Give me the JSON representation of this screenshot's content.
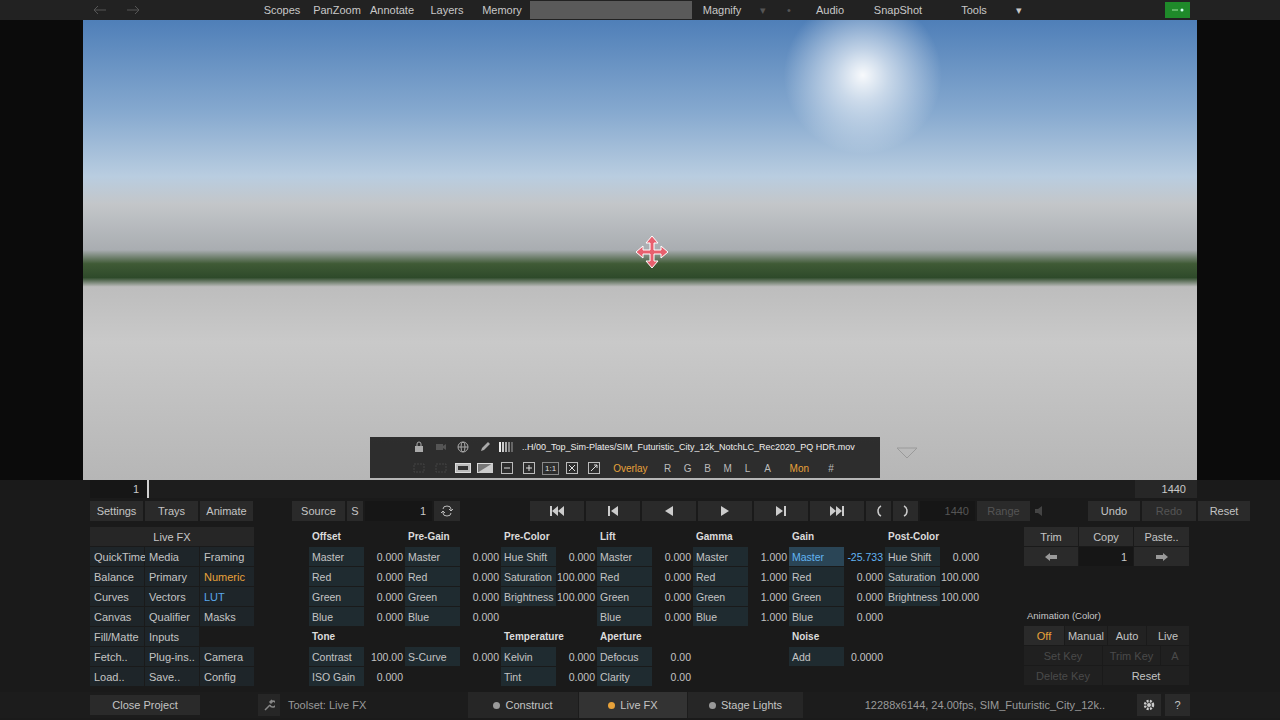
{
  "top_bar": {
    "menu": [
      {
        "label": "Scopes",
        "disabled": false
      },
      {
        "label": "PanZoom",
        "disabled": false
      },
      {
        "label": "Annotate",
        "disabled": false
      },
      {
        "label": "Layers",
        "disabled": false
      },
      {
        "label": "Memory",
        "disabled": false
      }
    ],
    "right_menu": [
      {
        "label": "Magnify",
        "disabled": false
      },
      {
        "label": "▾",
        "disabled": true
      },
      {
        "label": "•",
        "disabled": true
      },
      {
        "label": "Audio",
        "disabled": false
      },
      {
        "label": "SnapShot",
        "disabled": false
      },
      {
        "label": "Tools",
        "disabled": false
      },
      {
        "label": "▾",
        "disabled": false
      }
    ]
  },
  "viewer": {
    "filename": "..H/00_Top_Sim-Plates/SIM_Futuristic_City_12k_NotchLC_Rec2020_PQ HDR.mov",
    "zoom": "1:1",
    "toggles": [
      {
        "label": "Overlay",
        "on": true
      },
      {
        "label": "R",
        "on": false
      },
      {
        "label": "G",
        "on": false
      },
      {
        "label": "B",
        "on": false
      },
      {
        "label": "M",
        "on": false
      },
      {
        "label": "L",
        "on": false
      },
      {
        "label": "A",
        "on": false
      },
      {
        "label": "Mon",
        "on": true
      },
      {
        "label": "#",
        "on": false
      }
    ]
  },
  "timeline": {
    "start": "1",
    "end": "1440",
    "level": 0
  },
  "toolbar": {
    "left": [
      "Settings",
      "Trays",
      "Animate"
    ],
    "source": "Source",
    "s": "S",
    "frame": "1",
    "out_frame": {
      "value": "1440",
      "disabled": true
    },
    "range": {
      "label": "Range",
      "disabled": true
    },
    "edit": [
      {
        "label": "Undo",
        "disabled": false
      },
      {
        "label": "Redo",
        "disabled": true
      },
      {
        "label": "Reset",
        "disabled": false
      }
    ]
  },
  "menu": {
    "title": "Live FX",
    "items": [
      {
        "label": "QuickTime",
        "kind": "button",
        "selected": false,
        "highlighted": false
      },
      {
        "label": "Media",
        "kind": "button",
        "selected": false,
        "highlighted": false
      },
      {
        "label": "Framing",
        "kind": "button",
        "selected": false,
        "highlighted": false
      },
      {
        "label": "Balance",
        "kind": "button",
        "selected": false,
        "highlighted": false
      },
      {
        "label": "Primary",
        "kind": "button",
        "selected": false,
        "highlighted": false
      },
      {
        "label": "Numeric",
        "kind": "button",
        "selected": true,
        "highlighted": false
      },
      {
        "label": "Curves",
        "kind": "button",
        "selected": false,
        "highlighted": false
      },
      {
        "label": "Vectors",
        "kind": "button",
        "selected": false,
        "highlighted": false
      },
      {
        "label": "LUT",
        "kind": "button",
        "selected": false,
        "highlighted": true
      },
      {
        "label": "Canvas",
        "kind": "button",
        "selected": false,
        "highlighted": false
      },
      {
        "label": "Qualifier",
        "kind": "button",
        "selected": false,
        "highlighted": false
      },
      {
        "label": "Masks",
        "kind": "button",
        "selected": false,
        "highlighted": false
      },
      {
        "label": "Fill/Matte",
        "kind": "button",
        "selected": false,
        "highlighted": false
      },
      {
        "label": "Inputs",
        "kind": "button",
        "selected": false,
        "highlighted": false
      },
      {
        "label": "",
        "kind": "blank",
        "selected": false,
        "highlighted": false
      },
      {
        "label": "Fetch..",
        "kind": "button",
        "selected": false,
        "highlighted": false
      },
      {
        "label": "Plug-ins..",
        "kind": "button",
        "selected": false,
        "highlighted": false
      },
      {
        "label": "Camera",
        "kind": "button",
        "selected": false,
        "highlighted": false
      },
      {
        "label": "Load..",
        "kind": "button",
        "selected": false,
        "highlighted": false
      },
      {
        "label": "Save..",
        "kind": "button",
        "selected": false,
        "highlighted": false
      },
      {
        "label": "Config",
        "kind": "button",
        "selected": false,
        "highlighted": false
      }
    ]
  },
  "numeric": {
    "groups": [
      {
        "title": "Offset",
        "rows": [
          {
            "label": "Master",
            "value": "0.000",
            "selected": false
          },
          {
            "label": "Red",
            "value": "0.000",
            "selected": false
          },
          {
            "label": "Green",
            "value": "0.000",
            "selected": false
          },
          {
            "label": "Blue",
            "value": "0.000",
            "selected": false
          }
        ]
      },
      {
        "title": "Pre-Gain",
        "rows": [
          {
            "label": "Master",
            "value": "0.000",
            "selected": false
          },
          {
            "label": "Red",
            "value": "0.000",
            "selected": false
          },
          {
            "label": "Green",
            "value": "0.000",
            "selected": false
          },
          {
            "label": "Blue",
            "value": "0.000",
            "selected": false
          }
        ]
      },
      {
        "title": "Pre-Color",
        "rows": [
          {
            "label": "Hue Shift",
            "value": "0.000",
            "selected": false
          },
          {
            "label": "Saturation",
            "value": "100.000",
            "selected": false
          },
          {
            "label": "Brightness",
            "value": "100.000",
            "selected": false
          }
        ]
      },
      {
        "title": "Lift",
        "rows": [
          {
            "label": "Master",
            "value": "0.000",
            "selected": false
          },
          {
            "label": "Red",
            "value": "0.000",
            "selected": false
          },
          {
            "label": "Green",
            "value": "0.000",
            "selected": false
          },
          {
            "label": "Blue",
            "value": "0.000",
            "selected": false
          }
        ]
      },
      {
        "title": "Gamma",
        "rows": [
          {
            "label": "Master",
            "value": "1.000",
            "selected": false
          },
          {
            "label": "Red",
            "value": "1.000",
            "selected": false
          },
          {
            "label": "Green",
            "value": "1.000",
            "selected": false
          },
          {
            "label": "Blue",
            "value": "1.000",
            "selected": false
          }
        ]
      },
      {
        "title": "Gain",
        "rows": [
          {
            "label": "Master",
            "value": "-25.733",
            "selected": true
          },
          {
            "label": "Red",
            "value": "0.000",
            "selected": false
          },
          {
            "label": "Green",
            "value": "0.000",
            "selected": false
          },
          {
            "label": "Blue",
            "value": "0.000",
            "selected": false
          }
        ]
      },
      {
        "title": "Post-Color",
        "rows": [
          {
            "label": "Hue Shift",
            "value": "0.000",
            "selected": false
          },
          {
            "label": "Saturation",
            "value": "100.000",
            "selected": false
          },
          {
            "label": "Brightness",
            "value": "100.000",
            "selected": false
          }
        ]
      }
    ],
    "lower": [
      {
        "title": "Tone",
        "columns": [
          [
            {
              "label": "Contrast",
              "value": "100.00",
              "selected": false
            },
            {
              "label": "ISO Gain",
              "value": "0.000",
              "selected": false
            }
          ],
          [
            {
              "label": "S-Curve",
              "value": "0.000",
              "selected": false
            }
          ]
        ]
      },
      {
        "title": "Temperature",
        "columns": [
          [
            {
              "label": "Kelvin",
              "value": "0.000",
              "selected": false
            },
            {
              "label": "Tint",
              "value": "0.000",
              "selected": false
            }
          ]
        ]
      },
      {
        "title": "Aperture",
        "columns": [
          [
            {
              "label": "Defocus",
              "value": "0.00",
              "selected": false
            },
            {
              "label": "Clarity",
              "value": "0.00",
              "selected": false
            }
          ]
        ]
      },
      {
        "title": "Noise",
        "columns": [
          [
            {
              "label": "Add",
              "value": "0.0000",
              "selected": false
            }
          ]
        ]
      }
    ]
  },
  "right_panel": {
    "edit": [
      "Trim",
      "Copy",
      "Paste.."
    ],
    "index": "1",
    "animation_title": "Animation (Color)",
    "modes": [
      {
        "label": "Off",
        "selected": true
      },
      {
        "label": "Manual",
        "selected": false
      },
      {
        "label": "Auto",
        "selected": false
      },
      {
        "label": "Live",
        "selected": false
      }
    ],
    "keys": [
      [
        {
          "label": "Set Key",
          "disabled": true
        },
        {
          "label": "Trim Key",
          "disabled": true
        },
        {
          "label": "A",
          "disabled": true
        }
      ],
      [
        {
          "label": "Delete Key",
          "disabled": true
        },
        {
          "label": "Reset",
          "disabled": false
        }
      ]
    ]
  },
  "bottom_bar": {
    "close": "Close Project",
    "toolset": "Toolset: Live FX",
    "tabs": [
      {
        "label": "Construct",
        "selected": false
      },
      {
        "label": "Live FX",
        "selected": true
      },
      {
        "label": "Stage Lights",
        "selected": false
      }
    ],
    "status": "12288x6144, 24.00fps, SIM_Futuristic_City_12k..",
    "help": "?"
  }
}
